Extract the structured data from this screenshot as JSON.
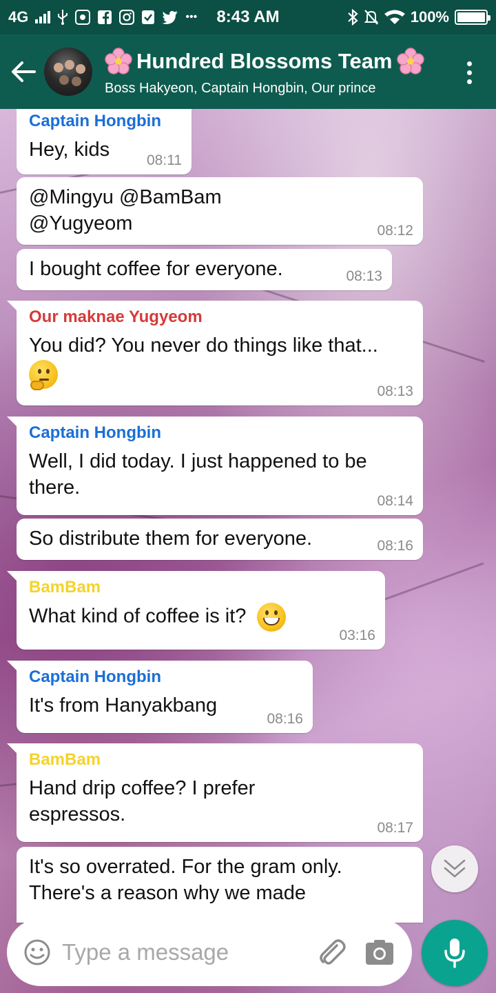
{
  "status_bar": {
    "network": "4G",
    "time": "8:43 AM",
    "battery": "100%",
    "battery_level": 1.0
  },
  "header": {
    "title": "Hundred Blossoms Team",
    "subtitle": "Boss Hakyeon, Captain Hongbin, Our prince"
  },
  "colors": {
    "header_bg": "#0e5c4f",
    "status_bg": "#0c4f44",
    "mic_bg": "#0aa38f",
    "sender_hongbin": "#1a6fd6",
    "sender_yugyeom": "#d63a3a",
    "sender_bambam": "#f5d327"
  },
  "messages": [
    {
      "sender": "Captain Hongbin",
      "text": "Hey, kids",
      "time": "08:11"
    },
    {
      "sender": "",
      "text": "@Mingyu @BamBam @Yugyeom",
      "time": "08:12"
    },
    {
      "sender": "",
      "text": "I bought coffee for everyone.",
      "time": "08:13"
    },
    {
      "sender": "Our maknae Yugyeom",
      "text": "You did? You never do things like that...",
      "emoji": "thinking-face",
      "time": "08:13"
    },
    {
      "sender": "Captain Hongbin",
      "text": "Well, I did today. I just happened to be there.",
      "time": "08:14"
    },
    {
      "sender": "",
      "text": "So distribute them for everyone.",
      "time": "08:16"
    },
    {
      "sender": "BamBam",
      "text": "What kind of coffee is it?",
      "emoji": "grinning-face",
      "time": "03:16"
    },
    {
      "sender": "Captain Hongbin",
      "text": "It's from Hanyakbang",
      "time": "08:16"
    },
    {
      "sender": "BamBam",
      "text": "Hand drip coffee? I prefer espressos.",
      "time": "08:17"
    },
    {
      "sender": "",
      "text": "It's so overrated. For the gram only. There's a reason why we made",
      "time": ""
    }
  ],
  "input": {
    "placeholder": "Type a message"
  }
}
